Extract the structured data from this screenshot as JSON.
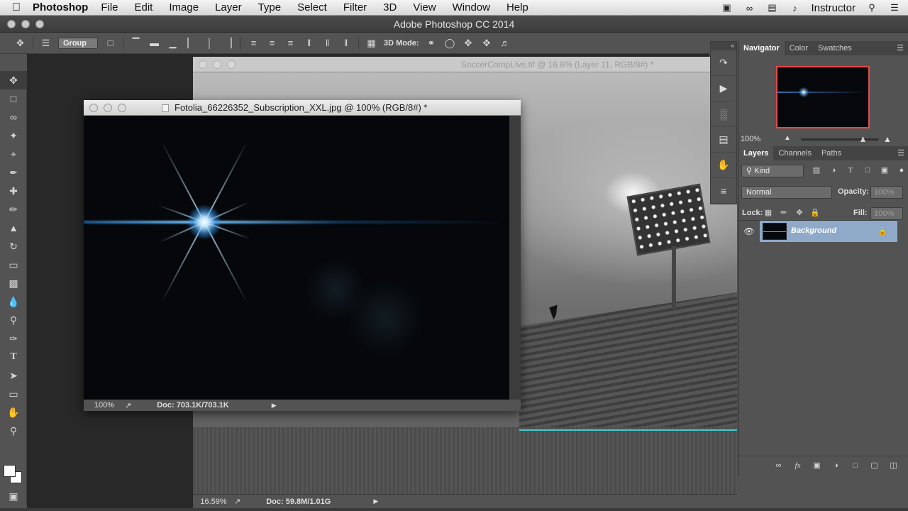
{
  "menubar": {
    "app": "Photoshop",
    "items": [
      "File",
      "Edit",
      "Image",
      "Layer",
      "Type",
      "Select",
      "Filter",
      "3D",
      "View",
      "Window",
      "Help"
    ],
    "user": "Instructor",
    "icons": [
      "apple-icon",
      "display-icon",
      "sync-icon",
      "screen-icon",
      "volume-icon",
      "search-icon",
      "list-icon"
    ]
  },
  "app_title": "Adobe Photoshop CC 2014",
  "options_bar": {
    "group_select": "Group",
    "mode_label": "3D Mode:"
  },
  "main_document": {
    "title": "SoccerCompLive.tif @ 16.6% (Layer 11, RGB/8#) *",
    "zoom": "16.59%",
    "doc_info": "Doc: 59.8M/1.01G"
  },
  "flare_document": {
    "title": "Fotolia_66226352_Subscription_XXL.jpg @ 100% (RGB/8#) *",
    "zoom": "100%",
    "doc_info": "Doc: 703.1K/703.1K"
  },
  "navigator_panel": {
    "tabs": [
      "Navigator",
      "Color",
      "Swatches"
    ],
    "zoom": "100%"
  },
  "layers_panel": {
    "tabs": [
      "Layers",
      "Channels",
      "Paths"
    ],
    "filter_kind": "Kind",
    "blend_mode": "Normal",
    "opacity_label": "Opacity:",
    "opacity_value": "100%",
    "lock_label": "Lock:",
    "fill_label": "Fill:",
    "fill_value": "100%",
    "layers": [
      {
        "name": "Background",
        "visible": true,
        "locked": true,
        "selected": true
      }
    ]
  },
  "colors": {
    "selected_layer": "#8fa9c9",
    "navigator_frame": "#e24a4a",
    "guide_line": "#46c9cf"
  }
}
